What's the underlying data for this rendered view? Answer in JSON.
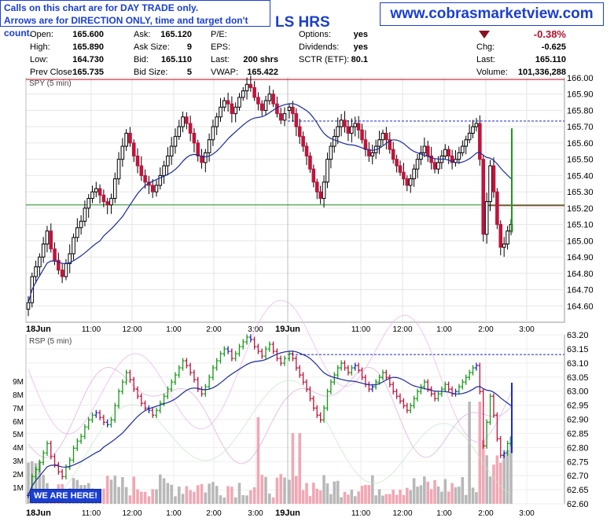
{
  "note": {
    "line1": "Calls on this chart are for DAY TRADE only.",
    "line2": "Arrows are for DIRECTION ONLY, time and target don't count."
  },
  "url": "www.cobrasmarketview.com",
  "title_fragment": "LS HRS",
  "quote": {
    "col1": [
      {
        "label": "Open:",
        "value": "165.600"
      },
      {
        "label": "High:",
        "value": "165.890"
      },
      {
        "label": "Low:",
        "value": "164.730"
      },
      {
        "label": "Prev Close:",
        "value": "165.735"
      }
    ],
    "col2": [
      {
        "label": "Ask:",
        "value": "165.120"
      },
      {
        "label": "Ask Size:",
        "value": "9"
      },
      {
        "label": "Bid:",
        "value": "165.110"
      },
      {
        "label": "Bid Size:",
        "value": "5"
      }
    ],
    "col3": [
      {
        "label": "P/E:",
        "value": ""
      },
      {
        "label": "EPS:",
        "value": ""
      },
      {
        "label": "Last:",
        "value": "200 shrs"
      },
      {
        "label": "VWAP:",
        "value": "165.422"
      }
    ],
    "col4": [
      {
        "label": "Options:",
        "value": "yes"
      },
      {
        "label": "Dividends:",
        "value": "yes"
      },
      {
        "label": "SCTR (ETF):",
        "value": "80.1"
      }
    ],
    "pct_change": "-0.38%",
    "col5": [
      {
        "label": "Chg:",
        "value": "-0.625"
      },
      {
        "label": "Last:",
        "value": "165.110"
      },
      {
        "label": "Volume:",
        "value": "101,336,288"
      }
    ]
  },
  "here_label": "WE ARE HERE!",
  "colors": {
    "up": "#000000",
    "down": "#c0143c",
    "ma": "#1a2a9a",
    "hline_red": "#b01020",
    "hline_green": "#1a8a1a",
    "dashed": "#1a2acc"
  },
  "chart_data": [
    {
      "type": "candlestick",
      "title": "SPY (5 min)",
      "ylim": [
        164.5,
        166.0
      ],
      "yticks": [
        "166.00",
        "165.90",
        "165.80",
        "165.70",
        "165.60",
        "165.50",
        "165.40",
        "165.30",
        "165.20",
        "165.10",
        "165.00",
        "164.90",
        "164.80",
        "164.70",
        "164.60"
      ],
      "xticks": [
        "18Jun",
        "11:00",
        "12:00",
        "1:00",
        "2:00",
        "3:00",
        "19Jun",
        "11:00",
        "12:00",
        "1:00",
        "2:00",
        "3:00"
      ],
      "hlines": [
        {
          "value": 165.99,
          "color": "red"
        },
        {
          "value": 165.735,
          "color": "blue-dashed"
        },
        {
          "value": 165.22,
          "color": "green"
        },
        {
          "value": 165.22,
          "color": "red"
        }
      ],
      "closes_day1": [
        164.62,
        164.78,
        164.84,
        164.9,
        164.98,
        165.06,
        164.95,
        164.88,
        164.82,
        164.78,
        164.86,
        164.92,
        165.02,
        165.08,
        165.12,
        165.2,
        165.26,
        165.3,
        165.32,
        165.28,
        165.24,
        165.22,
        165.26,
        165.38,
        165.5,
        165.58,
        165.66,
        165.6,
        165.52,
        165.46,
        165.4,
        165.36,
        165.34,
        165.3,
        165.34,
        165.4,
        165.46,
        165.52,
        165.58,
        165.64,
        165.7,
        165.76,
        165.72,
        165.66,
        165.6,
        165.52,
        165.48,
        165.54,
        165.62,
        165.7,
        165.76,
        165.82,
        165.86,
        165.84,
        165.78,
        165.82,
        165.88,
        165.92,
        165.96,
        165.94,
        165.88,
        165.84,
        165.8,
        165.86,
        165.9,
        165.84,
        165.78,
        165.74,
        165.78
      ],
      "closes_day2": [
        165.82,
        165.78,
        165.7,
        165.64,
        165.58,
        165.52,
        165.44,
        165.36,
        165.3,
        165.26,
        165.36,
        165.5,
        165.58,
        165.64,
        165.7,
        165.74,
        165.7,
        165.66,
        165.7,
        165.72,
        165.68,
        165.62,
        165.56,
        165.52,
        165.54,
        165.58,
        165.62,
        165.66,
        165.62,
        165.56,
        165.5,
        165.46,
        165.42,
        165.38,
        165.34,
        165.38,
        165.44,
        165.5,
        165.54,
        165.58,
        165.52,
        165.48,
        165.44,
        165.48,
        165.52,
        165.56,
        165.52,
        165.48,
        165.5,
        165.54,
        165.58,
        165.62,
        165.66,
        165.7,
        165.72,
        165.5,
        165.04,
        165.24,
        165.46,
        165.3,
        165.1,
        164.96,
        164.98,
        165.06,
        165.1
      ],
      "volume": {
        "yticks": [
          "9M",
          "8M",
          "7M",
          "6M",
          "5M",
          "4M",
          "3M",
          "2M",
          "1M"
        ]
      }
    },
    {
      "type": "ohlc",
      "title": "RSP (5 min)",
      "ylim": [
        62.6,
        63.2
      ],
      "yticks": [
        "63.20",
        "63.15",
        "63.10",
        "63.05",
        "63.00",
        "62.95",
        "62.90",
        "62.85",
        "62.80",
        "62.75",
        "62.70",
        "62.65",
        "62.60"
      ],
      "xticks": [
        "18Jun",
        "11:00",
        "12:00",
        "1:00",
        "2:00",
        "3:00",
        "19Jun",
        "11:00",
        "12:00",
        "1:00",
        "2:00",
        "3:00"
      ],
      "hlines": [
        {
          "value": 63.13,
          "color": "blue-dashed"
        }
      ]
    }
  ]
}
